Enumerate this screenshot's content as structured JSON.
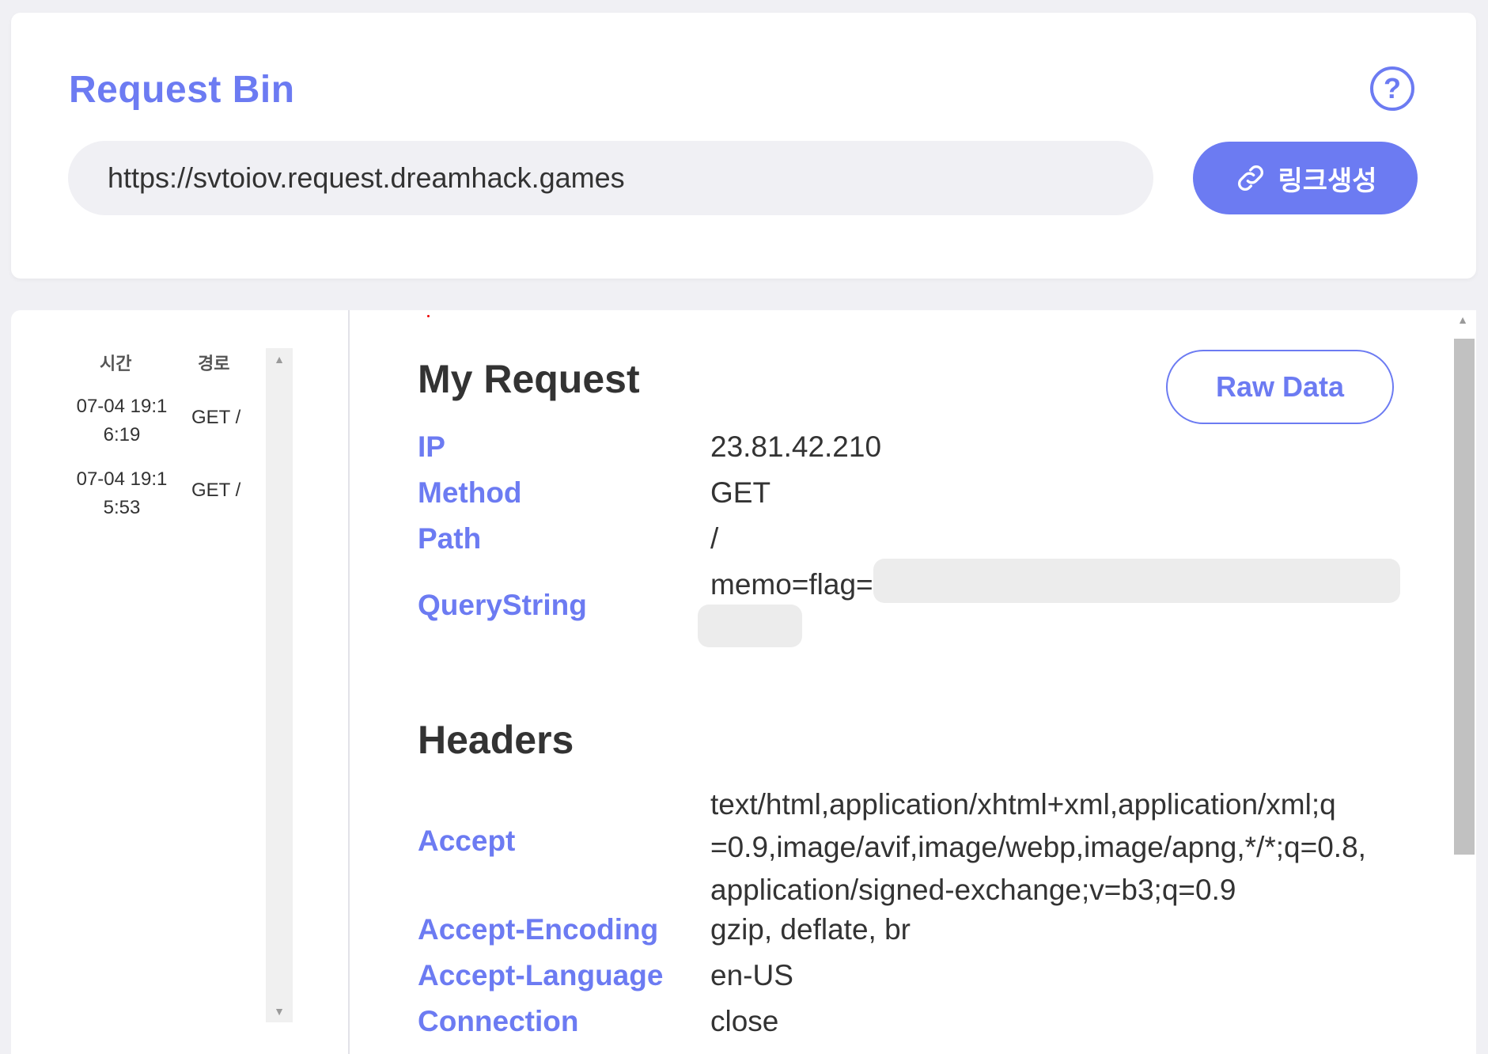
{
  "header": {
    "title": "Request Bin",
    "url_value": "https://svtoiov.request.dreamhack.games",
    "generate_label": "링크생성",
    "help_symbol": "?"
  },
  "sidebar": {
    "col_time": "시간",
    "col_path": "경로",
    "requests": [
      {
        "time_line1": "07-04 19:1",
        "time_line2": "6:19",
        "path": "GET /"
      },
      {
        "time_line1": "07-04 19:1",
        "time_line2": "5:53",
        "path": "GET /"
      }
    ]
  },
  "request": {
    "title": "My Request",
    "raw_data_label": "Raw Data",
    "fields": {
      "ip_label": "IP",
      "ip_value": "23.81.42.210",
      "method_label": "Method",
      "method_value": "GET",
      "path_label": "Path",
      "path_value": "/",
      "query_label": "QueryString",
      "query_value": "memo=flag="
    }
  },
  "headers": {
    "title": "Headers",
    "accept_label": "Accept",
    "accept_line1": "text/html,application/xhtml+xml,application/xml;q",
    "accept_line2": "=0.9,image/avif,image/webp,image/apng,*/*;q=0.8,",
    "accept_line3": "application/signed-exchange;v=b3;q=0.9",
    "accept_encoding_label": "Accept-Encoding",
    "accept_encoding_value": "gzip, deflate, br",
    "accept_language_label": "Accept-Language",
    "accept_language_value": "en-US",
    "connection_label": "Connection",
    "connection_value": "close"
  },
  "colors": {
    "accent": "#6c7bf2",
    "text": "#333333",
    "background": "#f0f0f4"
  },
  "icons": {
    "help": "question-circle-icon",
    "link": "link-icon"
  }
}
